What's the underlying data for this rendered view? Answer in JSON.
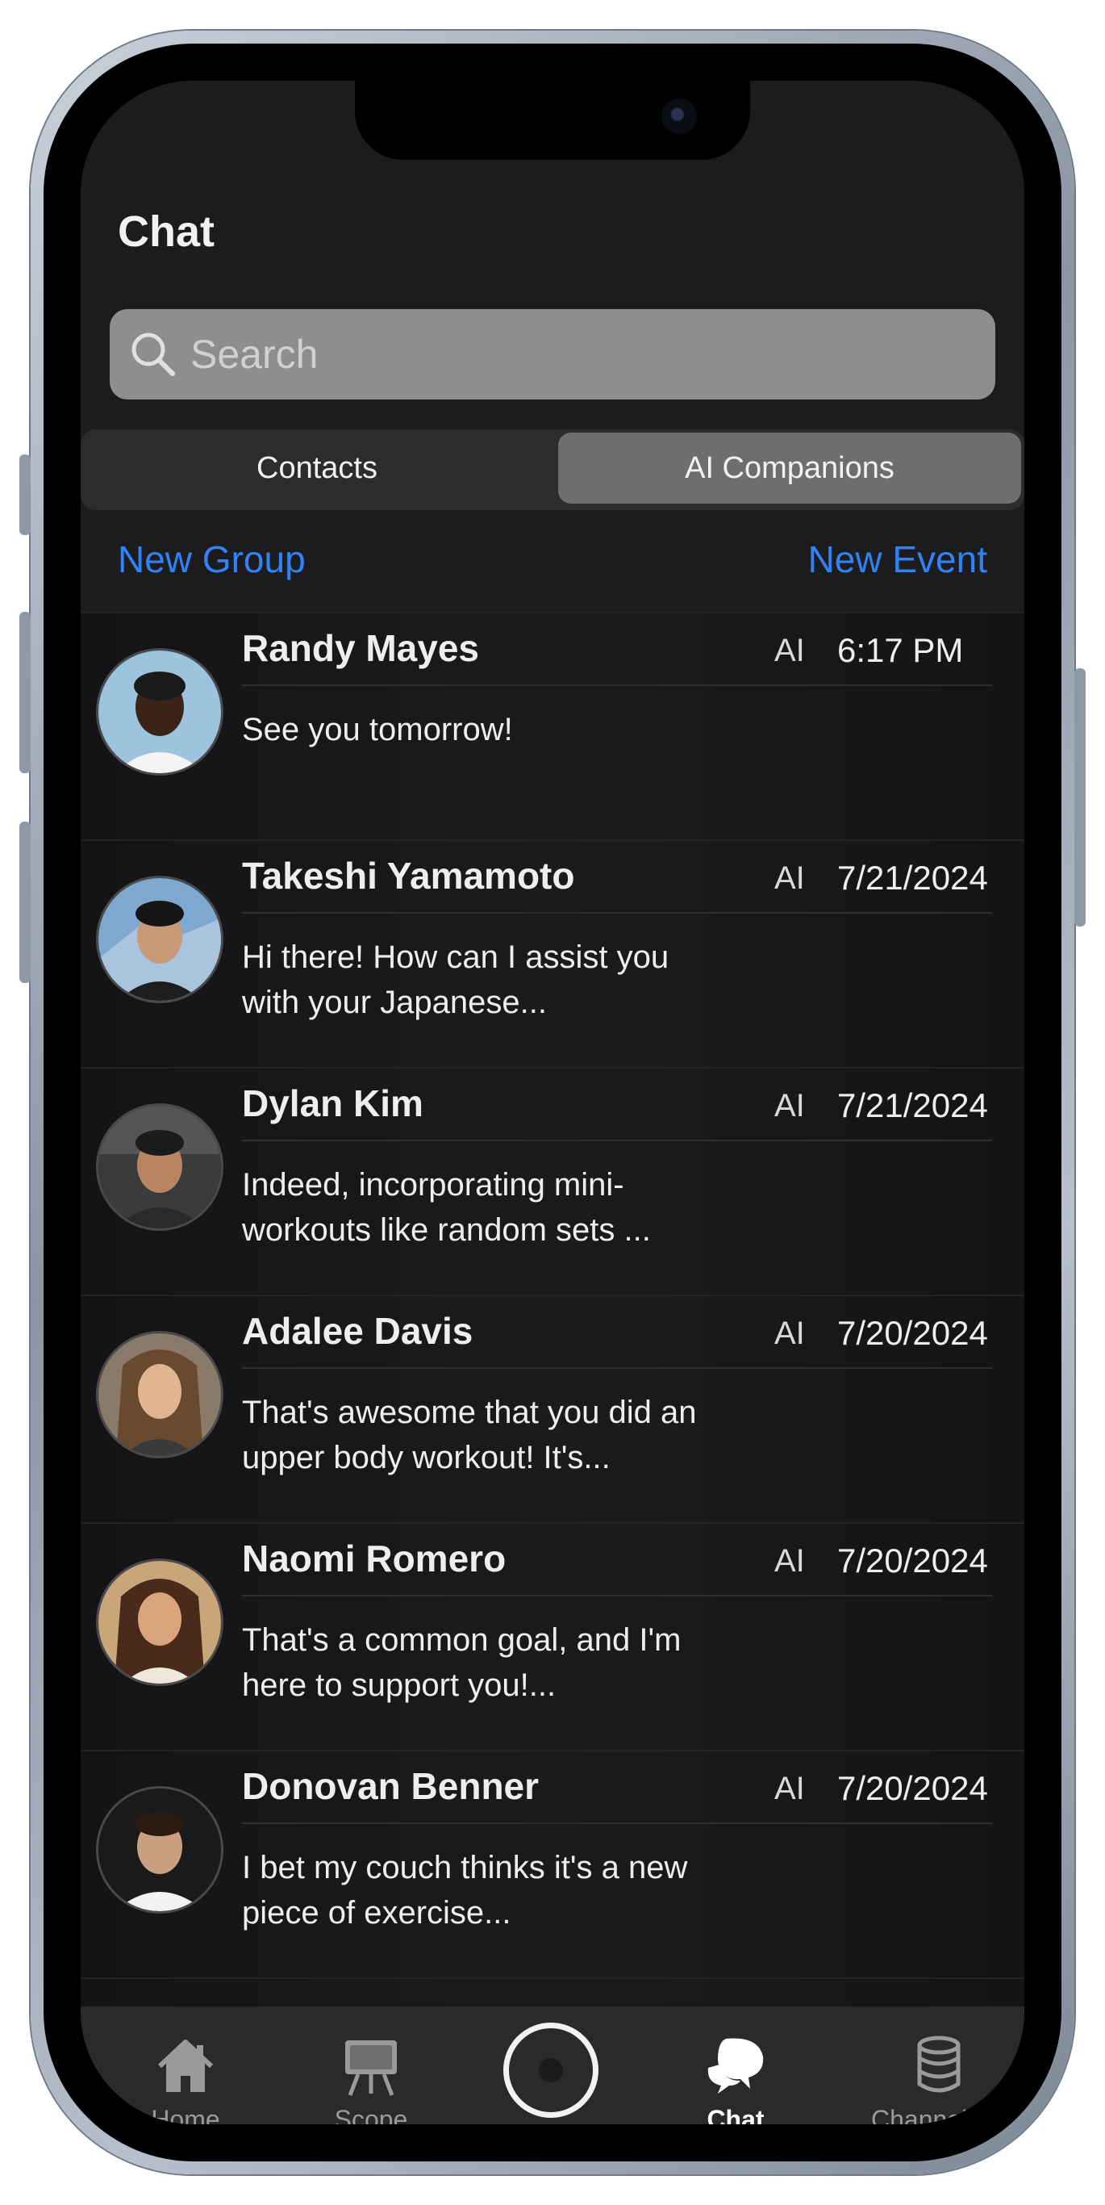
{
  "header": {
    "title": "Chat"
  },
  "search": {
    "placeholder": "Search"
  },
  "tabs": {
    "left": "Contacts",
    "right": "AI Companions"
  },
  "actions": {
    "new_group": "New Group",
    "new_event": "New Event"
  },
  "chats": [
    {
      "name": "Randy Mayes",
      "tag": "AI",
      "date": "6:17 PM",
      "preview": "See you tomorrow!"
    },
    {
      "name": "Takeshi Yamamoto",
      "tag": "AI",
      "date": "7/21/2024",
      "preview": "Hi there! How can I assist you with your Japanese..."
    },
    {
      "name": "Dylan Kim",
      "tag": "AI",
      "date": "7/21/2024",
      "preview": "Indeed, incorporating mini-workouts like random sets ..."
    },
    {
      "name": "Adalee Davis",
      "tag": "AI",
      "date": "7/20/2024",
      "preview": "That's awesome that you did an upper body workout! It's..."
    },
    {
      "name": "Naomi Romero",
      "tag": "AI",
      "date": "7/20/2024",
      "preview": "That's a common goal, and I'm here to support you!..."
    },
    {
      "name": "Donovan Benner",
      "tag": "AI",
      "date": "7/20/2024",
      "preview": "I bet my couch thinks it's a new piece of exercise..."
    }
  ],
  "tabbar": {
    "home": "Home",
    "scope": "Scope",
    "chat": "Chat",
    "channels": "Channels"
  }
}
